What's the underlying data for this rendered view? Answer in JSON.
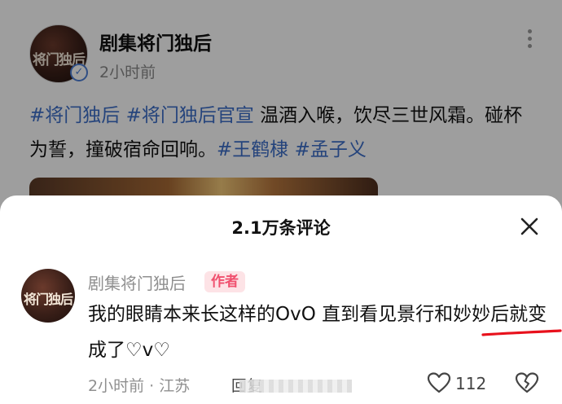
{
  "post": {
    "author": "剧集将门独后",
    "time": "2小时前",
    "avatar_text": "将门独后",
    "text_segments": [
      {
        "text": "#将门独后",
        "type": "tag"
      },
      {
        "text": " ",
        "type": "plain"
      },
      {
        "text": "#将门独后官宣",
        "type": "tag"
      },
      {
        "text": " 温酒入喉，饮尽三世风霜。碰杯为誓，撞破宿命回响。",
        "type": "plain"
      },
      {
        "text": "#王鹤棣",
        "type": "tag"
      },
      {
        "text": " ",
        "type": "plain"
      },
      {
        "text": "#孟子义",
        "type": "tag"
      }
    ]
  },
  "sheet": {
    "title": "2.1万条评论"
  },
  "comment": {
    "author": "剧集将门独后",
    "badge": "作者",
    "avatar_text": "将门独后",
    "text": "我的眼睛本来长这样的OvO 直到看见景行和妙妙后就变成了♡v♡",
    "meta": "2小时前 · 江苏",
    "reply_label": "回复",
    "like_count": "112"
  },
  "colors": {
    "tag_blue": "#3d6ec9",
    "badge_pink": "#f0506e",
    "underline_red": "#e8111c"
  }
}
